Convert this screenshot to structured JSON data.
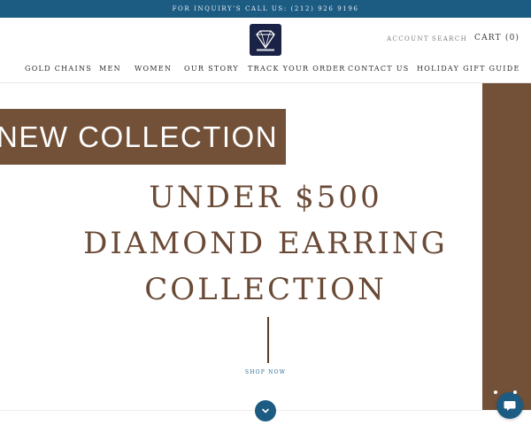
{
  "colors": {
    "topbar": "#1c5b82",
    "accent_brown": "#735138",
    "headline_brown": "#6a4a36",
    "link_blue": "#2a6b95",
    "logo_bg": "#1a2345"
  },
  "announcement": {
    "text": "FOR INQUIRY'S CALL US: (212) 926 9196"
  },
  "header": {
    "logo_icon": "diamond-logo-icon",
    "account_label": "ACCOUNT",
    "search_label": "SEARCH",
    "cart_label": "CART (0)"
  },
  "nav": {
    "items": [
      {
        "label": "GOLD CHAINS"
      },
      {
        "label": "MEN"
      },
      {
        "label": "WOMEN"
      },
      {
        "label": "OUR STORY"
      },
      {
        "label": "TRACK YOUR ORDER"
      },
      {
        "label": "CONTACT US"
      },
      {
        "label": "HOLIDAY GIFT GUIDE"
      }
    ]
  },
  "hero": {
    "banner_text": "NEW COLLECTION",
    "headline_lines": [
      "UNDER $500",
      "DIAMOND EARRING",
      "COLLECTION"
    ],
    "cta_label": "SHOP NOW",
    "scroll_icon": "chevron-down-icon"
  },
  "widgets": {
    "chat_icon": "chat-icon"
  }
}
